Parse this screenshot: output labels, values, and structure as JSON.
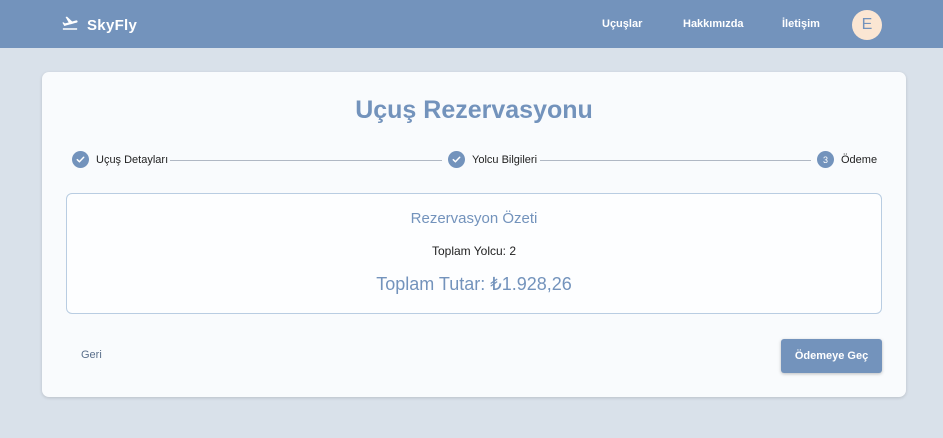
{
  "navbar": {
    "brand": "SkyFly",
    "links": [
      "Uçuşlar",
      "Hakkımızda",
      "İletişim"
    ],
    "avatar_initial": "E"
  },
  "booking": {
    "title": "Uçuş Rezervasyonu",
    "steps": [
      {
        "label": "Uçuş Detayları",
        "state": "completed"
      },
      {
        "label": "Yolcu Bilgileri",
        "state": "completed"
      },
      {
        "label": "Ödeme",
        "state": "active",
        "number": "3"
      }
    ],
    "summary": {
      "title": "Rezervasyon Özeti",
      "passengers": "Toplam Yolcu: 2",
      "total": "Toplam Tutar: ₺1.928,26"
    },
    "back_label": "Geri",
    "pay_label": "Ödemeye Geç"
  },
  "colors": {
    "primary": "#7393bc",
    "background": "#d9e1ea",
    "card": "#f9fbfd"
  }
}
